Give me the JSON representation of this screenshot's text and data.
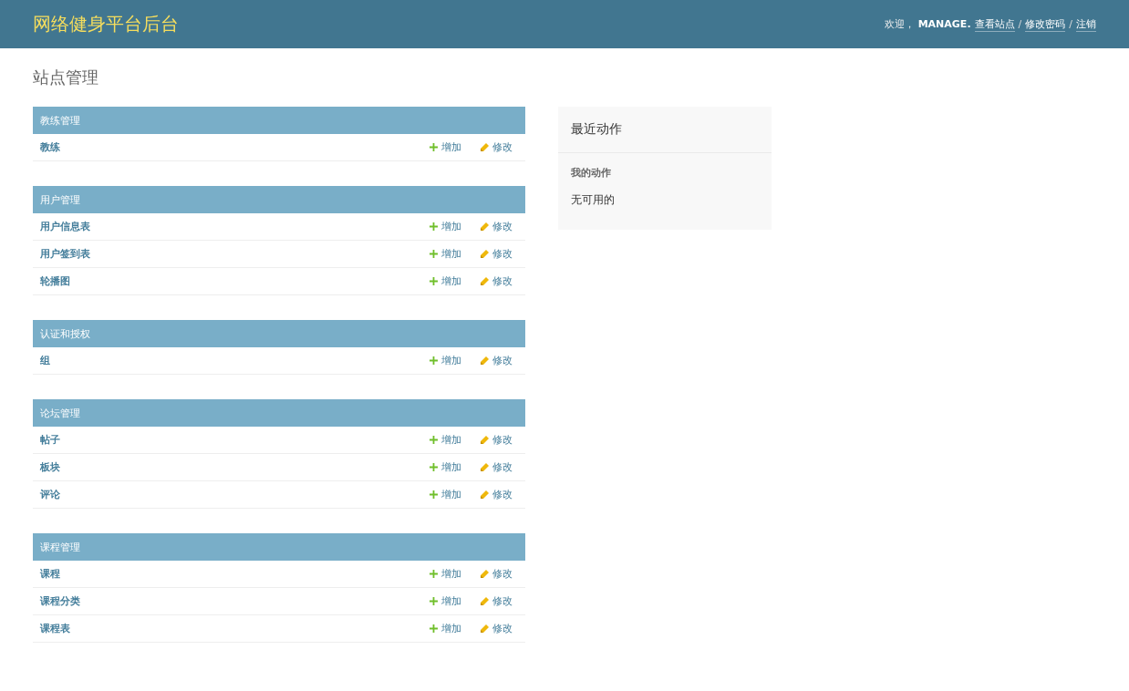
{
  "header": {
    "title": "网络健身平台后台",
    "welcome": "欢迎，",
    "username": "MANAGE.",
    "links": [
      {
        "label": "查看站点"
      },
      {
        "separator": "/",
        "label": "修改密码"
      },
      {
        "separator": "/",
        "label": "注销"
      }
    ]
  },
  "page_title": "站点管理",
  "modules": [
    {
      "caption": "教练管理",
      "models": [
        {
          "name": "教练",
          "add": "增加",
          "change": "修改"
        }
      ]
    },
    {
      "caption": "用户管理",
      "models": [
        {
          "name": "用户信息表",
          "add": "增加",
          "change": "修改"
        },
        {
          "name": "用户签到表",
          "add": "增加",
          "change": "修改"
        },
        {
          "name": "轮播图",
          "add": "增加",
          "change": "修改"
        }
      ]
    },
    {
      "caption": "认证和授权",
      "models": [
        {
          "name": "组",
          "add": "增加",
          "change": "修改"
        }
      ]
    },
    {
      "caption": "论坛管理",
      "models": [
        {
          "name": "帖子",
          "add": "增加",
          "change": "修改"
        },
        {
          "name": "板块",
          "add": "增加",
          "change": "修改"
        },
        {
          "name": "评论",
          "add": "增加",
          "change": "修改"
        }
      ]
    },
    {
      "caption": "课程管理",
      "models": [
        {
          "name": "课程",
          "add": "增加",
          "change": "修改"
        },
        {
          "name": "课程分类",
          "add": "增加",
          "change": "修改"
        },
        {
          "name": "课程表",
          "add": "增加",
          "change": "修改"
        }
      ]
    }
  ],
  "recent_actions": {
    "title": "最近动作",
    "subtitle": "我的动作",
    "empty": "无可用的"
  }
}
